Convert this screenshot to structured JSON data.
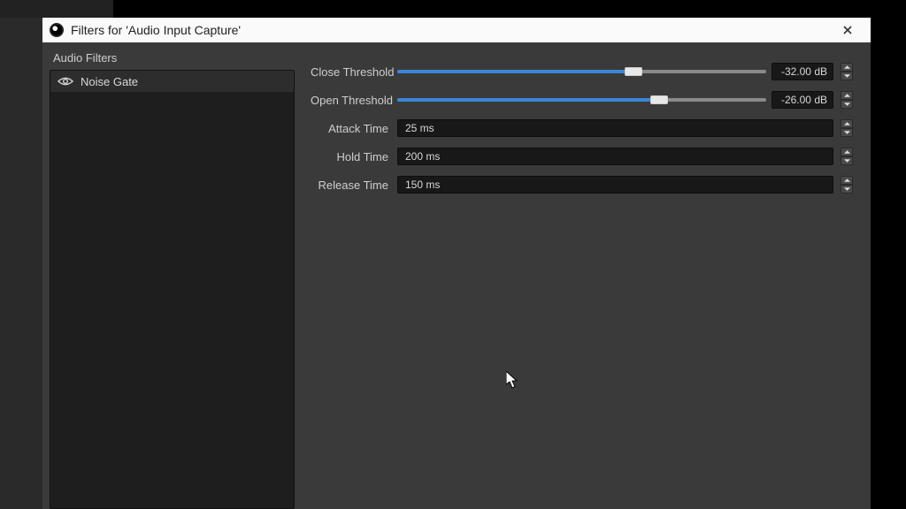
{
  "window": {
    "title": "Filters for 'Audio Input Capture'"
  },
  "sidebar": {
    "title": "Audio Filters",
    "items": [
      {
        "label": "Noise Gate"
      }
    ]
  },
  "props": {
    "close_threshold": {
      "label": "Close Threshold",
      "value": "-32.00 dB",
      "fill_pct": 64
    },
    "open_threshold": {
      "label": "Open Threshold",
      "value": "-26.00 dB",
      "fill_pct": 71
    },
    "attack_time": {
      "label": "Attack Time",
      "value": "25 ms"
    },
    "hold_time": {
      "label": "Hold Time",
      "value": "200 ms"
    },
    "release_time": {
      "label": "Release Time",
      "value": "150 ms"
    }
  }
}
